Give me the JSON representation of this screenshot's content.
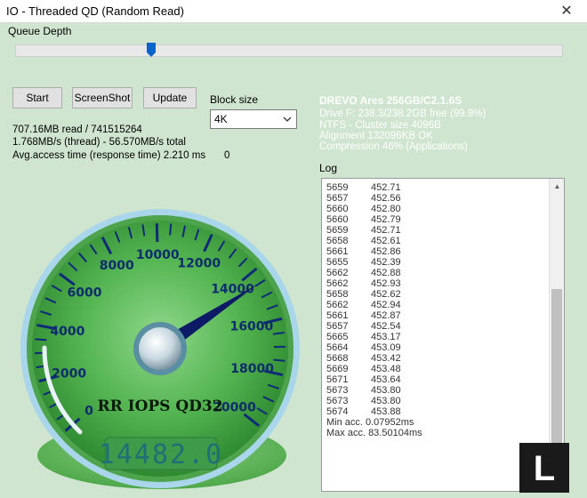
{
  "window": {
    "title": "IO - Threaded QD (Random Read)",
    "close_glyph": "✕"
  },
  "queue_depth": {
    "label": "Queue Depth",
    "level_fraction": 0.25
  },
  "buttons": {
    "start": "Start",
    "screenshot": "ScreenShot",
    "update": "Update"
  },
  "block_size": {
    "label": "Block size",
    "value": "4K"
  },
  "stats": {
    "line1": "707.16MB read / 741515264",
    "line2": "1.768MB/s (thread) - 56.570MB/s total",
    "line3": "Avg.access time (response time) 2.210 ms",
    "zero": "0"
  },
  "drive": {
    "name": "DREVO Ares 256GB/C2.1.6S",
    "lines": [
      "Drive F: 238.3/238.2GB free (99.9%)",
      "NTFS - Cluster size 4096B",
      "Alignment 132096KB OK",
      "Compression 46% (Applications)"
    ]
  },
  "log": {
    "label": "Log",
    "rows": [
      [
        "5659",
        "452.71"
      ],
      [
        "5657",
        "452.56"
      ],
      [
        "5660",
        "452.80"
      ],
      [
        "5660",
        "452.79"
      ],
      [
        "5659",
        "452.71"
      ],
      [
        "5658",
        "452.61"
      ],
      [
        "5661",
        "452.86"
      ],
      [
        "5655",
        "452.39"
      ],
      [
        "5662",
        "452.88"
      ],
      [
        "5662",
        "452.93"
      ],
      [
        "5658",
        "452.62"
      ],
      [
        "5662",
        "452.94"
      ],
      [
        "5661",
        "452.87"
      ],
      [
        "5657",
        "452.54"
      ],
      [
        "5665",
        "453.17"
      ],
      [
        "5664",
        "453.09"
      ],
      [
        "5668",
        "453.42"
      ],
      [
        "5669",
        "453.48"
      ],
      [
        "5671",
        "453.64"
      ],
      [
        "5673",
        "453.80"
      ],
      [
        "5673",
        "453.80"
      ],
      [
        "5674",
        "453.88"
      ]
    ],
    "min_acc": "Min acc. 0.07952ms",
    "max_acc": "Max acc. 83.50104ms"
  },
  "gauge": {
    "scale_labels": [
      "0",
      "2000",
      "4000",
      "6000",
      "8000",
      "10000",
      "12000",
      "14000",
      "16000",
      "18000",
      "20000"
    ],
    "max": 20000,
    "value": 14482,
    "caption": "RR IOPS QD32",
    "display": "14482.0",
    "colors": {
      "face": "#3e9a3e",
      "needle": "#0d1a66",
      "rim": "#a9d6ea"
    }
  },
  "watermark": {
    "text": "L"
  }
}
